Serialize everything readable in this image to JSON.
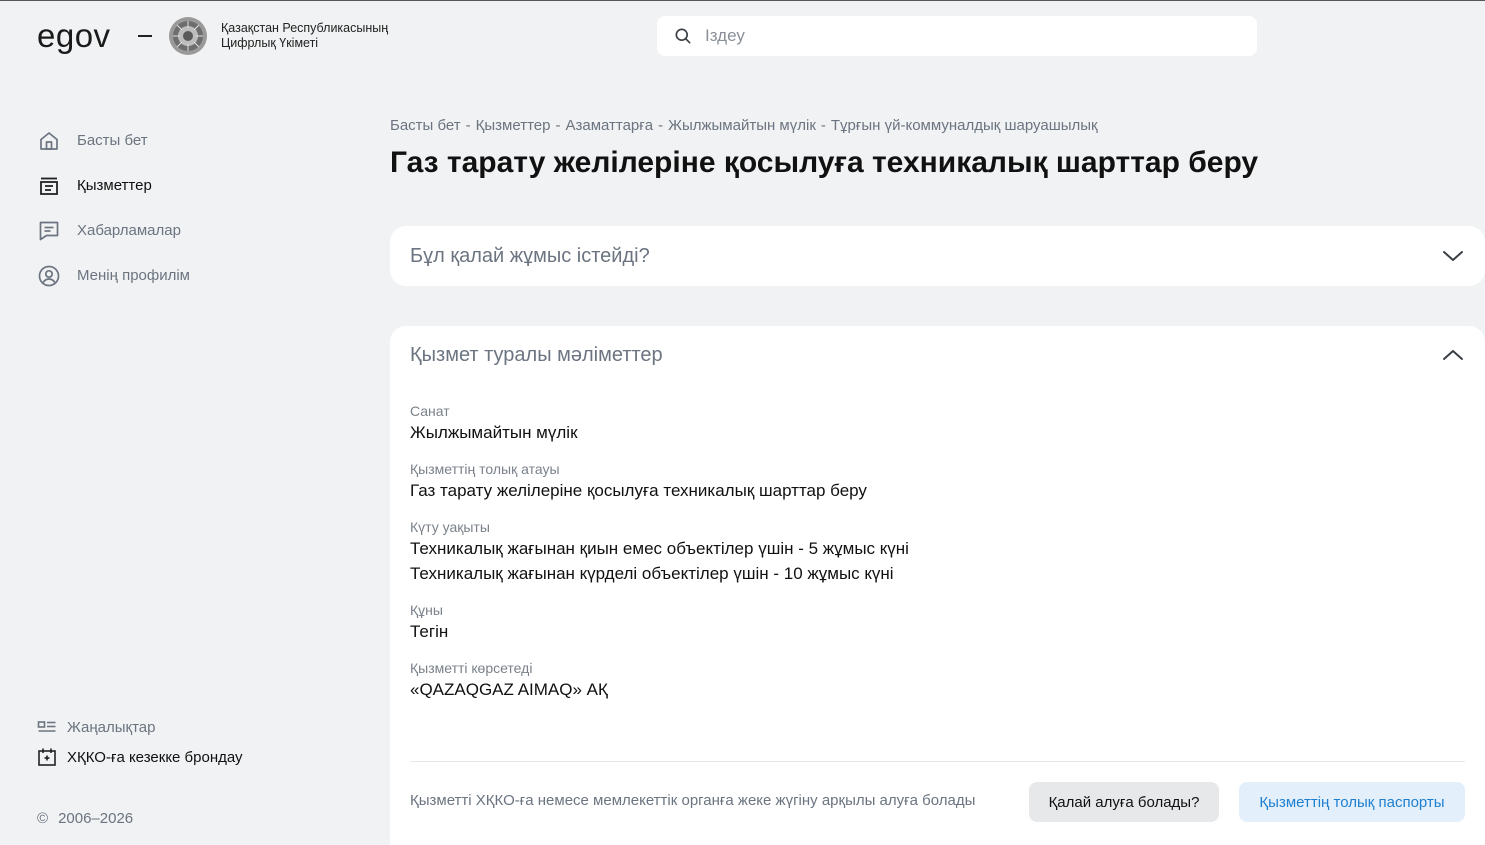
{
  "header": {
    "logo": "egov",
    "gov_line1": "Қазақстан Республикасының",
    "gov_line2": "Цифрлық Үкіметі",
    "search_placeholder": "Іздеу"
  },
  "sidebar": {
    "items": [
      {
        "label": "Басты бет",
        "icon": "home-icon"
      },
      {
        "label": "Қызметтер",
        "icon": "services-icon"
      },
      {
        "label": "Хабарламалар",
        "icon": "message-icon"
      },
      {
        "label": "Менің профилім",
        "icon": "user-icon"
      }
    ],
    "bottom_links": [
      {
        "label": "Жаңалықтар",
        "icon": "news-icon"
      },
      {
        "label": "ХҚКО-ға кезекке брондау",
        "icon": "calendar-icon"
      }
    ],
    "copyright_symbol": "©",
    "copyright_years": "2006–2026"
  },
  "breadcrumb": [
    "Басты бет",
    "Қызметтер",
    "Азаматтарға",
    "Жылжымайтын мүлік",
    "Тұрғын үй-коммуналдық шаруашылық"
  ],
  "breadcrumb_separator": "-",
  "title": "Газ тарату желілеріне қосылуға техникалық шарттар беру",
  "how_it_works": {
    "title": "Бұл қалай жұмыс істейді?"
  },
  "service_info": {
    "title": "Қызмет туралы мәліметтер",
    "fields": [
      {
        "label": "Санат",
        "values": [
          "Жылжымайтын мүлік"
        ]
      },
      {
        "label": "Қызметтің толық атауы",
        "values": [
          "Газ тарату желілеріне қосылуға техникалық шарттар беру"
        ]
      },
      {
        "label": "Күту уақыты",
        "values": [
          "Техникалық жағынан қиын емес объектілер үшін - 5 жұмыс күні",
          "Техникалық жағынан күрделі объектілер үшін - 10 жұмыс күні"
        ]
      },
      {
        "label": "Құны",
        "values": [
          "Тегін"
        ]
      },
      {
        "label": "Қызметті көрсетеді",
        "values": [
          "«QAZAQGAZ AIMAQ» АҚ"
        ]
      }
    ],
    "footer_note": "Қызметті ХҚКО-ға немесе мемлекеттік органға жеке жүгіну арқылы алуға болады",
    "how_button": "Қалай алуға болады?",
    "passport_button": "Қызметтің толық паспорты"
  },
  "colors": {
    "accent_blue": "#1f7fd0",
    "muted_text": "#6b7480",
    "background": "#f1f2f3"
  }
}
